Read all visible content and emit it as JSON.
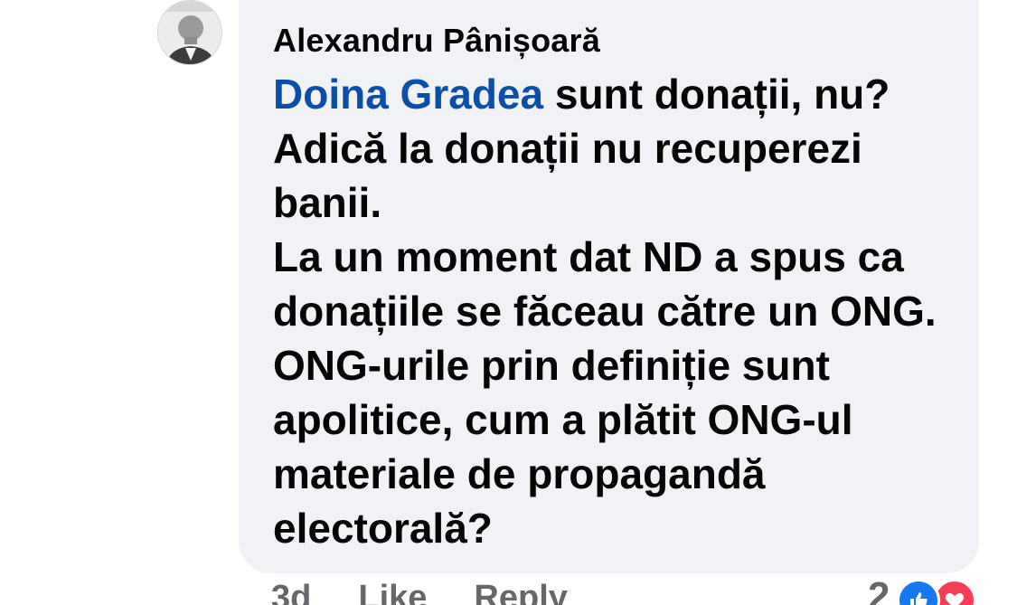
{
  "comment": {
    "author": "Alexandru Pânișoară",
    "mention": "Doina Gradea",
    "text_after_mention": " sunt donații, nu?\nAdică la donații nu recuperezi banii.\nLa un moment dat ND a spus ca donațiile se făceau către un ONG. ONG-urile prin definiție sunt apolitice, cum a plătit ONG-ul materiale de propagandă electorală?"
  },
  "actions": {
    "time": "3d",
    "like_label": "Like",
    "reply_label": "Reply"
  },
  "reactions": {
    "count": "2",
    "icons": [
      "thumbs-up-icon",
      "heart-icon"
    ]
  },
  "colors": {
    "bubble": "#f0f2f5",
    "mention": "#0b4fa8",
    "like_reaction": "#1877f2",
    "love_reaction": "#f33e58",
    "meta_text": "#65676b"
  }
}
